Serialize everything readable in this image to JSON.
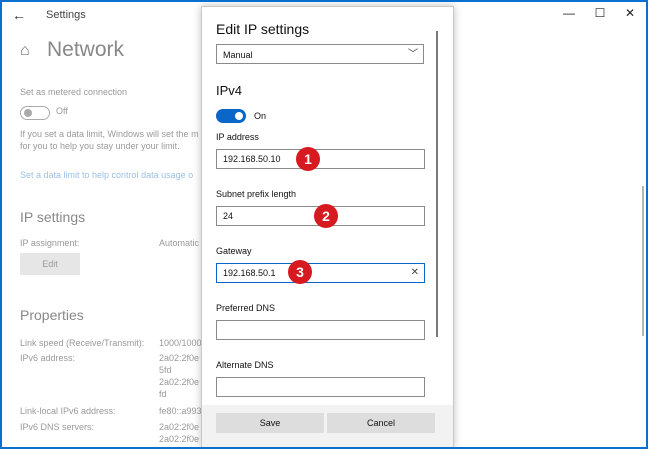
{
  "window": {
    "title": "Settings",
    "back_icon": "back-arrow-icon",
    "controls": [
      "—",
      "☐",
      "✕"
    ]
  },
  "background": {
    "page_title": "Network",
    "metered_label": "Set as metered connection",
    "toggle_off": "Off",
    "limit_text_1": "If you set a data limit, Windows will set the m",
    "limit_text_2": "for you to help you stay under your limit.",
    "limit_link": "Set a data limit to help control data usage o",
    "ip_settings_header": "IP settings",
    "ip_assignment_label": "IP assignment:",
    "ip_assignment_value": "Automatic",
    "edit_label": "Edit",
    "properties_header": "Properties",
    "props": [
      {
        "label": "Link speed (Receive/Transmit):",
        "value": "1000/1000"
      },
      {
        "label": "IPv6 address:",
        "value": "2a02:2f0e"
      },
      {
        "label": "",
        "value": "5fd"
      },
      {
        "label": "",
        "value": "2a02:2f0e"
      },
      {
        "label": "",
        "value": "fd"
      },
      {
        "label": "Link-local IPv6 address:",
        "value": "fe80::a993"
      },
      {
        "label": "IPv6 DNS servers:",
        "value": "2a02:2f0e"
      },
      {
        "label": "",
        "value": "2a02:2f0e"
      }
    ]
  },
  "dialog": {
    "title": "Edit IP settings",
    "mode_select": "Manual",
    "section": "IPv4",
    "toggle_state": "On",
    "fields": [
      {
        "label": "IP address",
        "value": "192.168.50.10",
        "badge": "1"
      },
      {
        "label": "Subnet prefix length",
        "value": "24",
        "badge": "2"
      },
      {
        "label": "Gateway",
        "value": "192.168.50.1",
        "badge": "3"
      },
      {
        "label": "Preferred DNS",
        "value": ""
      },
      {
        "label": "Alternate DNS",
        "value": ""
      }
    ],
    "save_label": "Save",
    "cancel_label": "Cancel"
  },
  "colors": {
    "accent": "#0a66c8",
    "badge": "#d71920",
    "frame": "#0b6fd1"
  }
}
